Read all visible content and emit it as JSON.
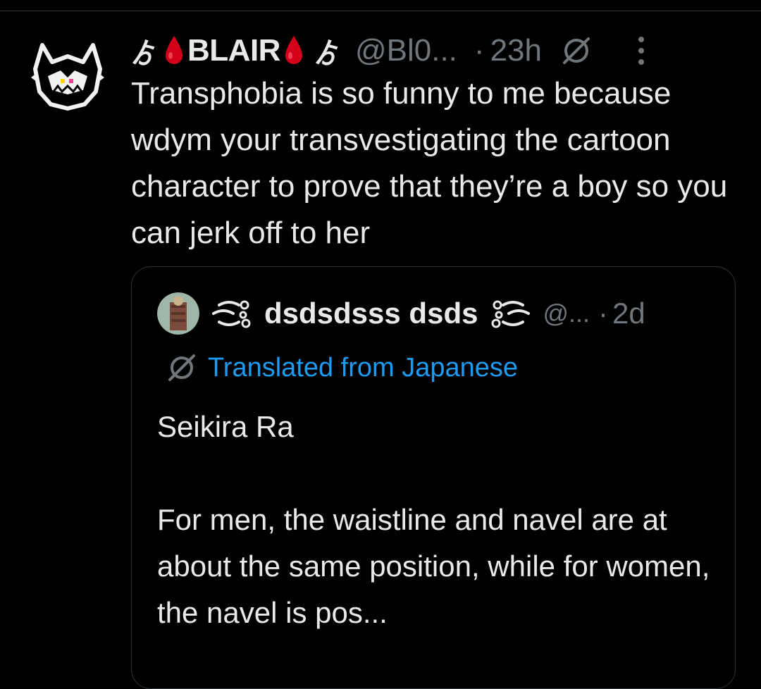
{
  "post": {
    "author": {
      "symbol_left": "ゟ",
      "name": "BLAIR",
      "symbol_right": "ゟ",
      "handle": "@Bl0...",
      "separator": "·",
      "time": "23h"
    },
    "text": "Transphobia is so funny to me because wdym your transvestigating the cartoon character to prove that they’re a boy so you can jerk off to her",
    "icons": {
      "drop": "blood-drop-icon",
      "grok": "grok-icon",
      "more": "more-options-icon"
    }
  },
  "quote": {
    "author": {
      "name": "dsdsdsss dsds",
      "handle": "@...",
      "separator": "·",
      "time": "2d"
    },
    "translated_label": "Translated from Japanese",
    "body": "Seikira Ra\n\nFor men, the waistline and navel are at about the same position, while for women, the navel is pos..."
  },
  "colors": {
    "background": "#000000",
    "text": "#e7e9ea",
    "muted": "#71767b",
    "link": "#1d9bf0",
    "border": "#2f3336",
    "drop": "#d4001a"
  }
}
